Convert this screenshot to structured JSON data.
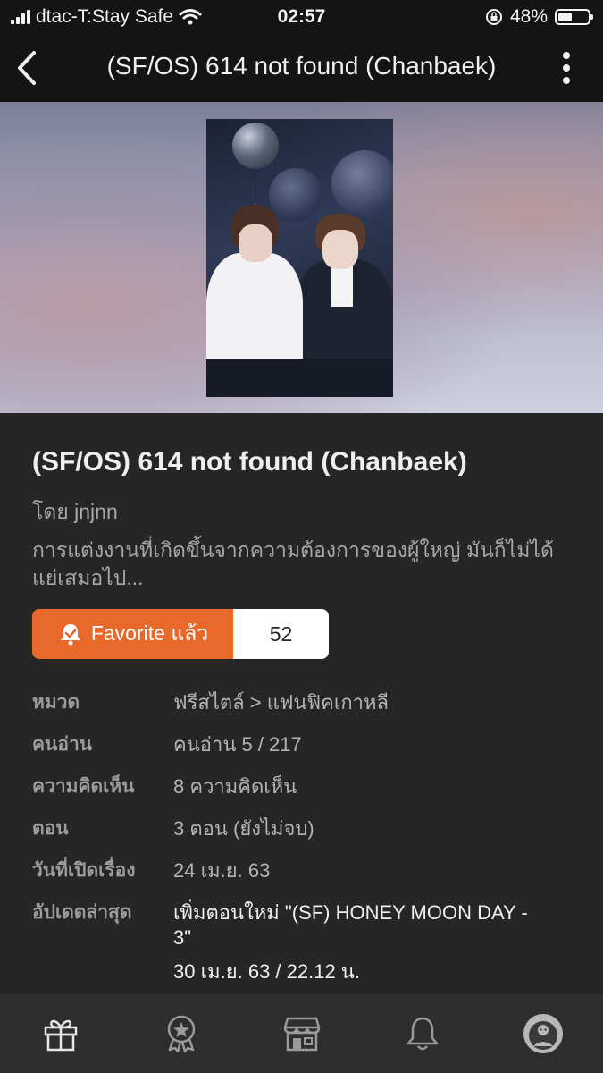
{
  "status_bar": {
    "carrier": "dtac-T:Stay Safe",
    "time": "02:57",
    "battery_percent": "48%",
    "battery_level": 0.48
  },
  "nav": {
    "title": "(SF/OS) 614 not found (Chanbaek)",
    "back_icon": "chevron-left-icon",
    "more_icon": "more-vertical-icon"
  },
  "story": {
    "title": "(SF/OS) 614 not found (Chanbaek)",
    "author": "โดย jnjnn",
    "description": "การแต่งงานที่เกิดขึ้นจากความต้องการของผู้ใหญ่ มันก็ไม่ได้แย่เสมอไป..."
  },
  "favorite": {
    "label": "Favorite แล้ว",
    "count": "52",
    "color": "#e8692a"
  },
  "meta": [
    {
      "label": "หมวด",
      "value": "ฟรีสไตล์ > แฟนฟิคเกาหลี"
    },
    {
      "label": "คนอ่าน",
      "value": "คนอ่าน 5 / 217"
    },
    {
      "label": "ความคิดเห็น",
      "value": "8 ความคิดเห็น"
    },
    {
      "label": "ตอน",
      "value": "3 ตอน (ยังไม่จบ)"
    },
    {
      "label": "วันที่เปิดเรื่อง",
      "value": "24 เม.ย. 63"
    }
  ],
  "last_update": {
    "label": "อัปเดตล่าสุด",
    "title": "เพิ่มตอนใหม่ \"(SF) HONEY MOON DAY - 3\"",
    "date": "30 เม.ย. 63 / 22.12 น."
  },
  "tabs": [
    {
      "icon": "gift-icon"
    },
    {
      "icon": "award-icon"
    },
    {
      "icon": "store-icon"
    },
    {
      "icon": "bell-icon"
    },
    {
      "icon": "profile-avatar-icon"
    }
  ]
}
